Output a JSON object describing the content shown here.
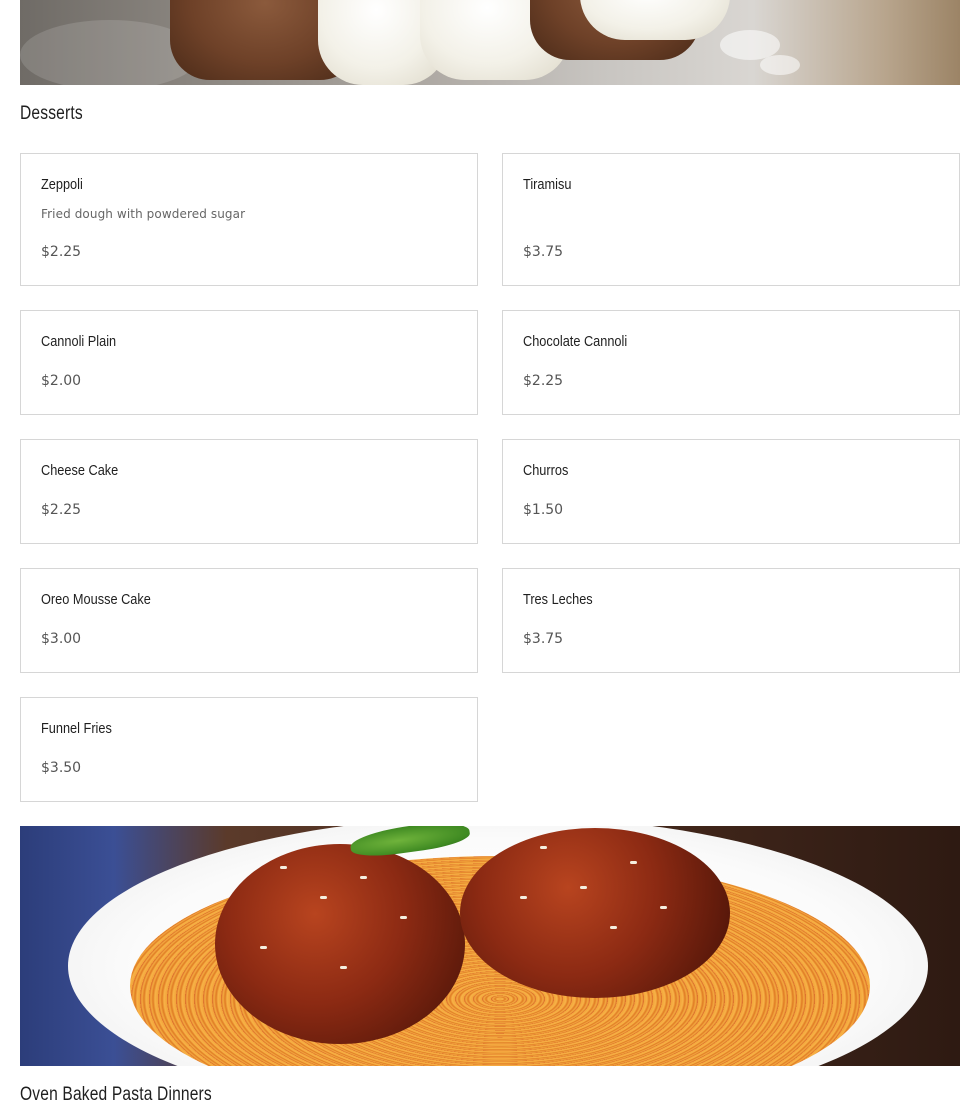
{
  "sections": [
    {
      "title": "Desserts",
      "items": [
        {
          "name": "Zeppoli",
          "description": "Fried dough with powdered sugar",
          "price": "$2.25"
        },
        {
          "name": "Tiramisu",
          "description": "",
          "price": "$3.75"
        },
        {
          "name": "Cannoli Plain",
          "description": "",
          "price": "$2.00"
        },
        {
          "name": "Chocolate Cannoli",
          "description": "",
          "price": "$2.25"
        },
        {
          "name": "Cheese Cake",
          "description": "",
          "price": "$2.25"
        },
        {
          "name": "Churros",
          "description": "",
          "price": "$1.50"
        },
        {
          "name": "Oreo Mousse Cake",
          "description": "",
          "price": "$3.00"
        },
        {
          "name": "Tres Leches",
          "description": "",
          "price": "$3.75"
        },
        {
          "name": "Funnel Fries",
          "description": "",
          "price": "$3.50"
        }
      ]
    },
    {
      "title": "Oven Baked Pasta Dinners",
      "items": []
    }
  ]
}
